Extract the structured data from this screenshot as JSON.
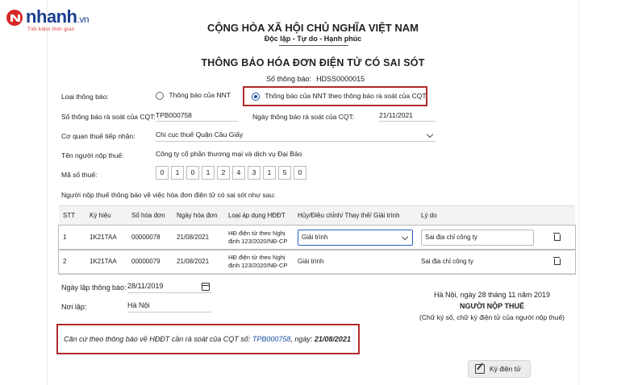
{
  "logo": {
    "brand": "nhanh",
    "suffix": ".vn",
    "slogan": "Tiết kiệm thời gian"
  },
  "header": {
    "nation": "CỘNG HÒA XÃ HỘI CHỦ NGHĨA VIỆT NAM",
    "motto": "Độc lập - Tự do - Hạnh phúc",
    "title": "THÔNG BÁO HÓA ĐƠN ĐIỆN TỬ CÓ SAI SÓT",
    "doc_no_label": "Số thông báo:",
    "doc_no_value": "HDSS0000015"
  },
  "form": {
    "type_label": "Loại thông báo:",
    "type_option1": "Thông báo của NNT",
    "type_option2": "Thông báo của NNT theo thông báo rà soát của CQT",
    "review_no_label": "Số thông báo rà soát của CQT:",
    "review_no_value": "TPB000758",
    "review_date_label": "Ngày thông báo rà soát của CQT:",
    "review_date_value": "21/11/2021",
    "tax_office_label": "Cơ quan thuế tiếp nhận:",
    "tax_office_value": "Chi cục thuế Quận Cầu Giấy",
    "taxpayer_label": "Tên người nộp thuế:",
    "taxpayer_value": "Công ty cổ phần thương mại và dịch vụ Đại Bảo",
    "tax_code_label": "Mã số thuế:",
    "tax_code_digits": [
      "0",
      "1",
      "0",
      "1",
      "2",
      "4",
      "3",
      "1",
      "5",
      "0"
    ],
    "intro": "Người nộp thuế thông báo về việc hóa đơn điện tử có sai sót như sau:"
  },
  "table": {
    "headers": [
      "STT",
      "Ký hiệu",
      "Số hóa đơn",
      "Ngày hóa đơn",
      "Loại áp dụng HĐĐT",
      "Hủy/Điều chỉnh/ Thay thế/ Giải trình",
      "Lý do"
    ],
    "rows": [
      {
        "stt": "1",
        "symbol": "1K21TAA",
        "number": "00000078",
        "date": "21/08/2021",
        "type_line1": "HĐ điện tử theo Nghị",
        "type_line2": "định 123/2020/NĐ-CP",
        "action": "Giải trình",
        "reason": "Sai địa chỉ công ty"
      },
      {
        "stt": "2",
        "symbol": "1K21TAA",
        "number": "00000079",
        "date": "21/08/2021",
        "type_line1": "HĐ điện tử theo Nghị",
        "type_line2": "định 123/2020/NĐ-CP",
        "action": "Giải trình",
        "reason": "Sai địa chỉ công ty"
      }
    ]
  },
  "footer": {
    "date_label": "Ngày lập thông báo:",
    "date_value": "28/11/2019",
    "place_label": "Nơi lập:",
    "place_value": "Hà Nội",
    "sign_place_date": "Hà Nội, ngày 28 tháng 11 năm 2019",
    "signer_title": "NGƯỜI NỘP THUẾ",
    "signer_note": "(Chữ ký số, chữ ký điện tử của người nộp thuế)",
    "basis_prefix": "Căn cứ theo thông báo về HĐĐT cần rà soát của CQT số: ",
    "basis_no": "TPB000758",
    "basis_mid": ", ngày: ",
    "basis_date": "21/08/2021",
    "sign_button": "Ký điện tử"
  },
  "colors": {
    "accent": "#1a4fa0",
    "highlight_border": "#b02a2a",
    "brand": "#1a3f8f"
  }
}
